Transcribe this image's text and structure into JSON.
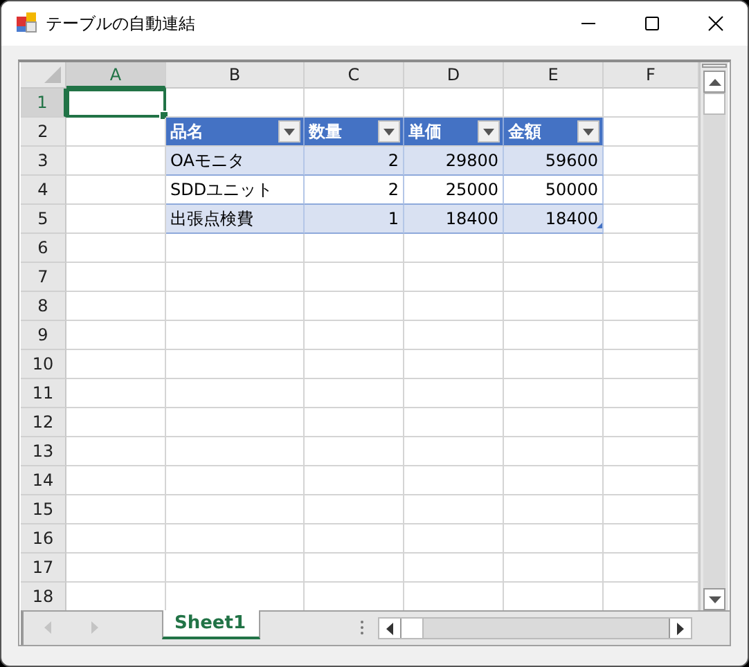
{
  "window": {
    "title": "テーブルの自動連結"
  },
  "sheet": {
    "columns": [
      {
        "label": "A",
        "selected": true
      },
      {
        "label": "B",
        "selected": false
      },
      {
        "label": "C",
        "selected": false
      },
      {
        "label": "D",
        "selected": false
      },
      {
        "label": "E",
        "selected": false
      },
      {
        "label": "F",
        "selected": false
      }
    ],
    "rows": [
      {
        "label": "1",
        "selected": true,
        "cells": [
          {
            "kind": "blank",
            "active": true
          }
        ]
      },
      {
        "label": "2",
        "selected": false,
        "cells": [
          {
            "kind": "blank"
          },
          {
            "kind": "header",
            "text": "品名"
          },
          {
            "kind": "header",
            "text": "数量"
          },
          {
            "kind": "header",
            "text": "単価"
          },
          {
            "kind": "header",
            "text": "金額"
          }
        ]
      },
      {
        "label": "3",
        "selected": false,
        "cells": [
          {
            "kind": "blank"
          },
          {
            "kind": "text",
            "text": "OAモニタ",
            "band": true
          },
          {
            "kind": "number",
            "text": "2",
            "band": true
          },
          {
            "kind": "number",
            "text": "29800",
            "band": true
          },
          {
            "kind": "number",
            "text": "59600",
            "band": true
          }
        ]
      },
      {
        "label": "4",
        "selected": false,
        "cells": [
          {
            "kind": "blank"
          },
          {
            "kind": "text",
            "text": "SDDユニット",
            "band": false
          },
          {
            "kind": "number",
            "text": "2",
            "band": false
          },
          {
            "kind": "number",
            "text": "25000",
            "band": false
          },
          {
            "kind": "number",
            "text": "50000",
            "band": false
          }
        ]
      },
      {
        "label": "5",
        "selected": false,
        "cells": [
          {
            "kind": "blank"
          },
          {
            "kind": "text",
            "text": "出張点検費",
            "band": true
          },
          {
            "kind": "number",
            "text": "1",
            "band": true
          },
          {
            "kind": "number",
            "text": "18400",
            "band": true
          },
          {
            "kind": "number",
            "text": "18400",
            "band": true,
            "table_end": true
          }
        ]
      },
      {
        "label": "6",
        "selected": false
      },
      {
        "label": "7",
        "selected": false
      },
      {
        "label": "8",
        "selected": false
      },
      {
        "label": "9",
        "selected": false
      },
      {
        "label": "10",
        "selected": false
      },
      {
        "label": "11",
        "selected": false
      },
      {
        "label": "12",
        "selected": false
      },
      {
        "label": "13",
        "selected": false
      },
      {
        "label": "14",
        "selected": false
      },
      {
        "label": "15",
        "selected": false
      },
      {
        "label": "16",
        "selected": false
      },
      {
        "label": "17",
        "selected": false
      },
      {
        "label": "18",
        "selected": false
      }
    ]
  },
  "sheet_tabs": [
    {
      "label": "Sheet1",
      "selected": true
    }
  ]
}
